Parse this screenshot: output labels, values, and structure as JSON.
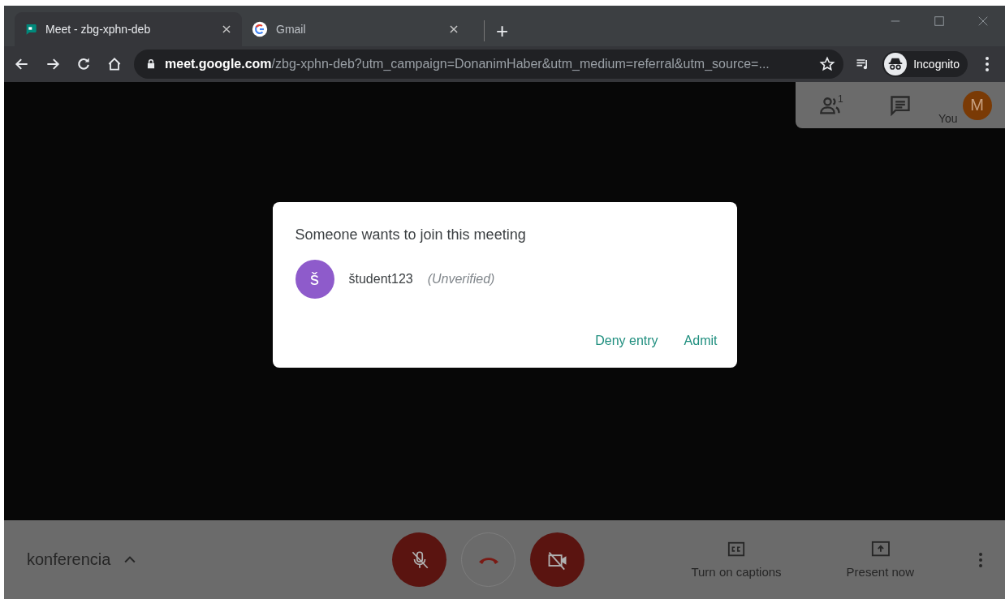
{
  "tabs": [
    {
      "title": "Meet - zbg-xphn-deb",
      "selected": true
    },
    {
      "title": "Gmail",
      "selected": false
    }
  ],
  "new_tab": "+",
  "address_bar": {
    "host": "meet.google.com",
    "path": "/zbg-xphn-deb?utm_campaign=DonanimHaber&utm_medium=referral&utm_source=..."
  },
  "profile": {
    "label": "Incognito"
  },
  "meeting_panel": {
    "participant_count": "1",
    "self": {
      "initial": "M",
      "label": "You"
    }
  },
  "dialog": {
    "title": "Someone wants to join this meeting",
    "requester": {
      "initial": "š",
      "name": "študent123",
      "note": "(Unverified)"
    },
    "actions": [
      "Deny entry",
      "Admit"
    ]
  },
  "bottom_bar": {
    "meeting_name": "konferencia",
    "mic_muted": true,
    "camera_off": true,
    "captions_label": "Turn on captions",
    "present_label": "Present now"
  }
}
